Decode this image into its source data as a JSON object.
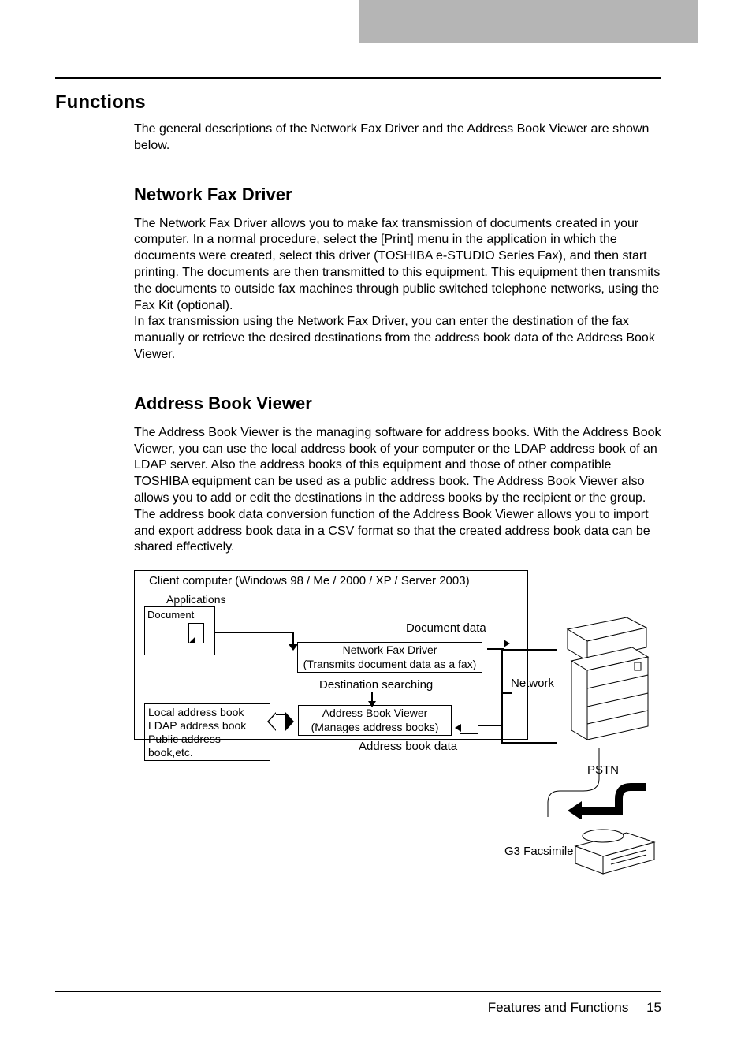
{
  "page": {
    "h1": "Functions",
    "intro": "The general descriptions of the Network Fax Driver and the Address Book Viewer are shown below.",
    "section1": {
      "title": "Network Fax Driver",
      "body": "The Network Fax Driver allows you to make fax transmission of documents created in your computer. In a normal procedure, select the [Print] menu in the application in which the documents were created, select this driver (TOSHIBA e-STUDIO Series Fax), and then start printing. The documents are then transmitted to this equipment. This equipment then transmits the documents to outside fax machines through public switched telephone networks, using the Fax Kit (optional).\nIn fax transmission using the Network Fax Driver, you can enter the destination of the fax manually or retrieve the desired destinations from the address book data of the Address Book Viewer."
    },
    "section2": {
      "title": "Address Book Viewer",
      "body": "The Address Book Viewer is the managing software for address books. With the Address Book Viewer, you can use the local address book of your computer or the LDAP address book of an LDAP server. Also the address books of this equipment and those of other compatible TOSHIBA equipment can be used as a public address book. The Address Book Viewer also allows you to add or edit the destinations in the address books by the recipient or the group.\nThe address book data conversion function of the Address Book Viewer allows you to import and export address book data in a CSV format so that the created address book data can be shared effectively."
    }
  },
  "diagram": {
    "client_title": "Client computer (Windows 98 / Me / 2000 / XP / Server 2003)",
    "applications": "Applications",
    "document": "Document",
    "nfd_line1": "Network Fax Driver",
    "nfd_line2": "(Transmits document data as a fax)",
    "abv_line1": "Address Book Viewer",
    "abv_line2": "(Manages address books)",
    "addr1": "Local address book",
    "addr2": "LDAP address book",
    "addr3": "Public address book,etc.",
    "doc_data": "Document data",
    "dest_search": "Destination searching",
    "network": "Network",
    "abd": "Address book data",
    "pstn": "PSTN",
    "g3": "G3 Facsimile"
  },
  "footer": {
    "title": "Features and Functions",
    "page_number": "15"
  }
}
